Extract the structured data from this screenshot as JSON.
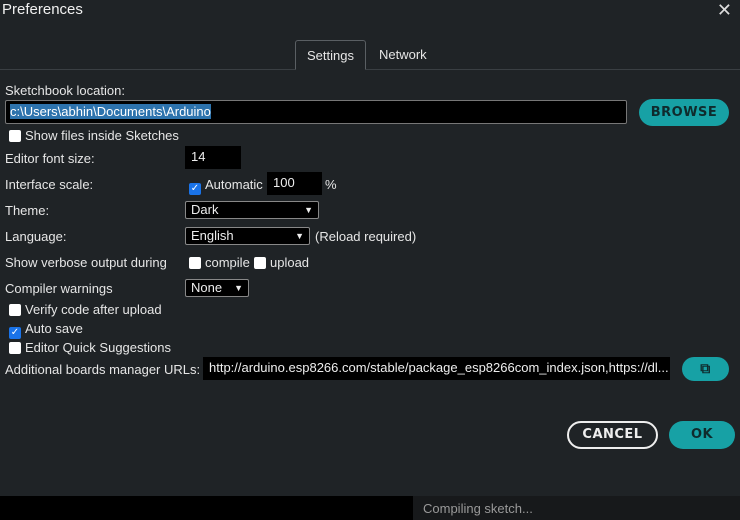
{
  "window": {
    "title": "Preferences",
    "close_icon": "close-icon"
  },
  "tabs": [
    {
      "label": "Settings",
      "active": true
    },
    {
      "label": "Network",
      "active": false
    }
  ],
  "sketchbook": {
    "label": "Sketchbook location:",
    "value": "c:\\Users\\abhin\\Documents\\Arduino",
    "browse_label": "BROWSE",
    "show_files_label": "Show files inside Sketches",
    "show_files_checked": false
  },
  "editor_font": {
    "label": "Editor font size:",
    "value": "14"
  },
  "interface_scale": {
    "label": "Interface scale:",
    "automatic_label": "Automatic",
    "automatic_checked": true,
    "value": "100",
    "unit": "%"
  },
  "theme": {
    "label": "Theme:",
    "value": "Dark"
  },
  "language": {
    "label": "Language:",
    "value": "English",
    "note": "(Reload required)"
  },
  "verbose": {
    "label": "Show verbose output during",
    "compile_label": "compile",
    "upload_label": "upload",
    "compile_checked": false,
    "upload_checked": false
  },
  "compiler_warnings": {
    "label": "Compiler warnings",
    "value": "None"
  },
  "verify": {
    "label": "Verify code after upload",
    "checked": false
  },
  "autosave": {
    "label": "Auto save",
    "checked": true
  },
  "quick_suggestions": {
    "label": "Editor Quick Suggestions",
    "checked": false
  },
  "boards_urls": {
    "label": "Additional boards manager URLs:",
    "value": "http://arduino.esp8266.com/stable/package_esp8266com_index.json,https://dl..."
  },
  "buttons": {
    "cancel": "CANCEL",
    "ok": "OK"
  },
  "status": {
    "text": "Compiling sketch..."
  },
  "colors": {
    "accent": "#17a1a5",
    "background": "#1f2326"
  }
}
